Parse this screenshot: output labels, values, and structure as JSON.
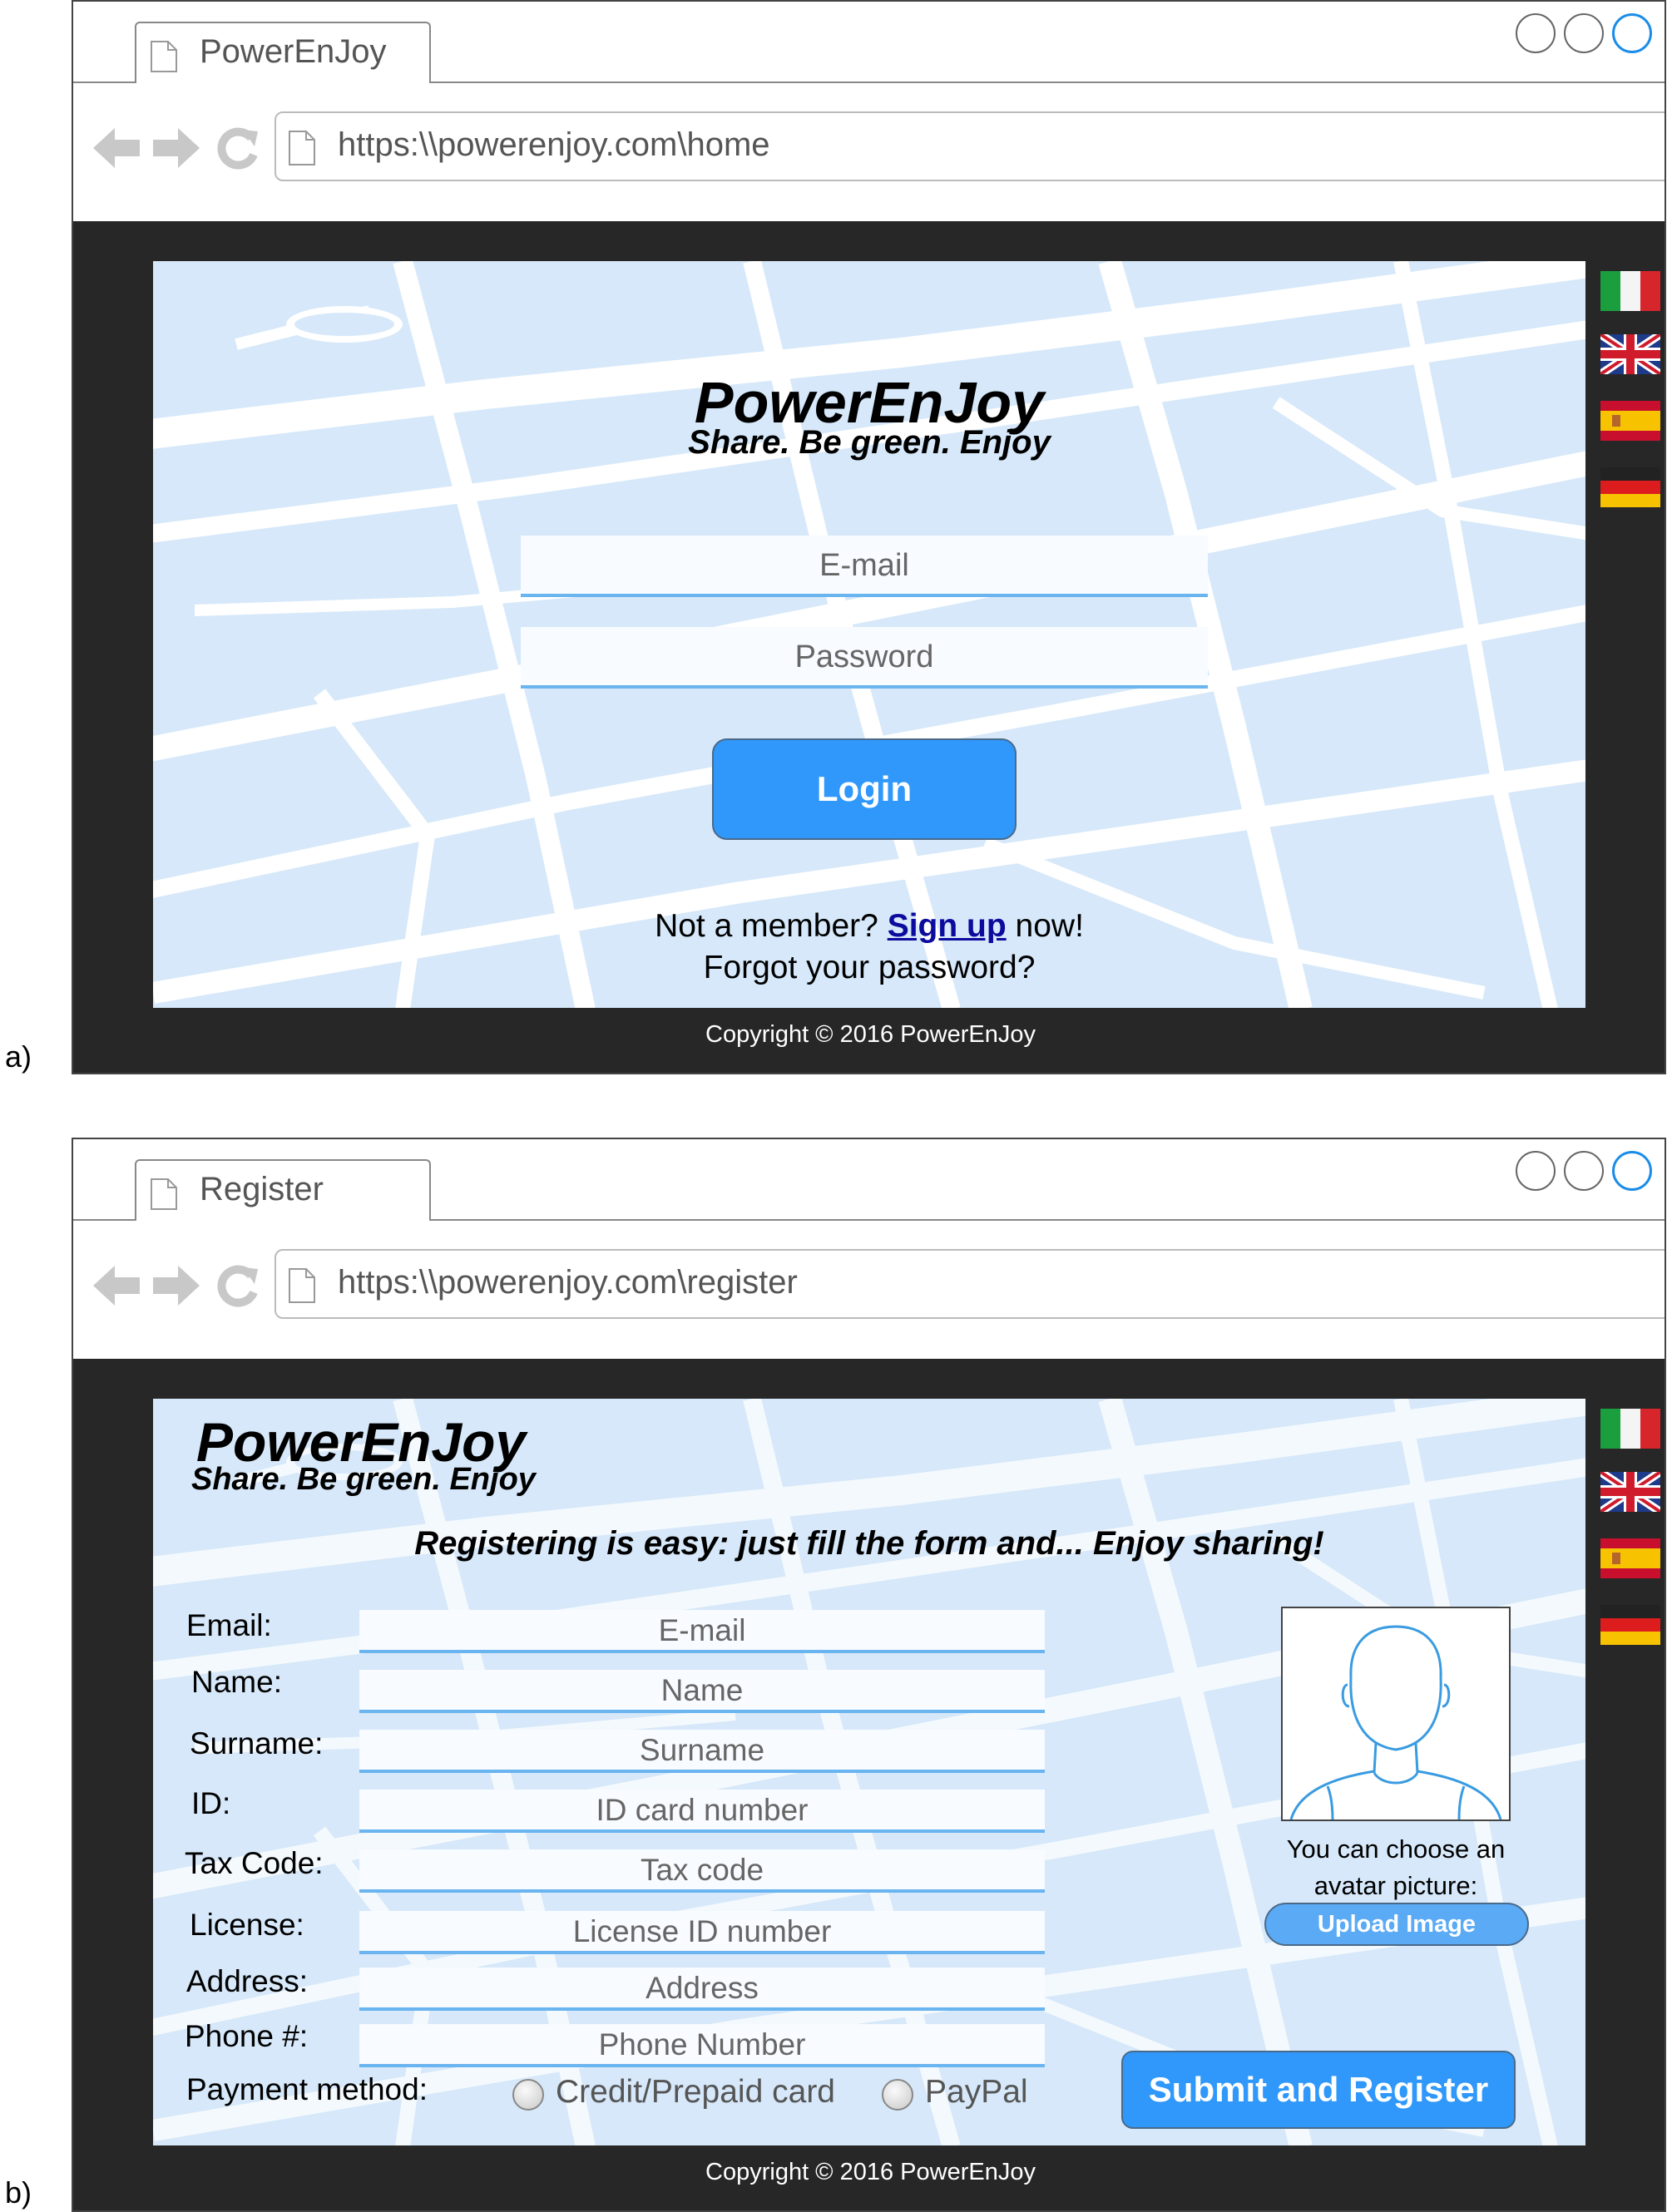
{
  "panel_a": {
    "label": "a)",
    "tab_title": "PowerEnJoy",
    "url": "https:\\\\powerenjoy.com\\home",
    "brand": "PowerEnJoy",
    "tagline": "Share. Be green. Enjoy",
    "email_placeholder": "E-mail",
    "password_placeholder": "Password",
    "login_label": "Login",
    "not_member_pre": "Not a member?",
    "sign_up": "Sign up",
    "not_member_post": "now!",
    "forgot": "Forgot your password?",
    "copyright": "Copyright © 2016 PowerEnJoy"
  },
  "panel_b": {
    "label": "b)",
    "tab_title": "Register",
    "url": "https:\\\\powerenjoy.com\\register",
    "brand": "PowerEnJoy",
    "tagline": "Share. Be green. Enjoy",
    "headline": "Registering is easy: just fill the form and... Enjoy sharing!",
    "fields": [
      {
        "label": "Email:",
        "placeholder": "E-mail"
      },
      {
        "label": "Name:",
        "placeholder": "Name"
      },
      {
        "label": "Surname:",
        "placeholder": "Surname"
      },
      {
        "label": "ID:",
        "placeholder": "ID card number"
      },
      {
        "label": "Tax Code:",
        "placeholder": "Tax code"
      },
      {
        "label": "License:",
        "placeholder": "License ID number"
      },
      {
        "label": "Address:",
        "placeholder": "Address"
      },
      {
        "label": "Phone #:",
        "placeholder": "Phone Number"
      }
    ],
    "payment_label": "Payment method:",
    "payment_options": [
      "Credit/Prepaid card",
      "PayPal"
    ],
    "avatar_caption_1": "You can choose an",
    "avatar_caption_2": "avatar picture:",
    "upload_label": "Upload Image",
    "submit_label": "Submit and Register",
    "copyright": "Copyright © 2016 PowerEnJoy"
  },
  "languages": [
    "italian-flag",
    "uk-flag",
    "spanish-flag",
    "german-flag"
  ],
  "colors": {
    "accent": "#2f98fa",
    "map_bg": "#d6e8f9",
    "frame": "#272727"
  }
}
